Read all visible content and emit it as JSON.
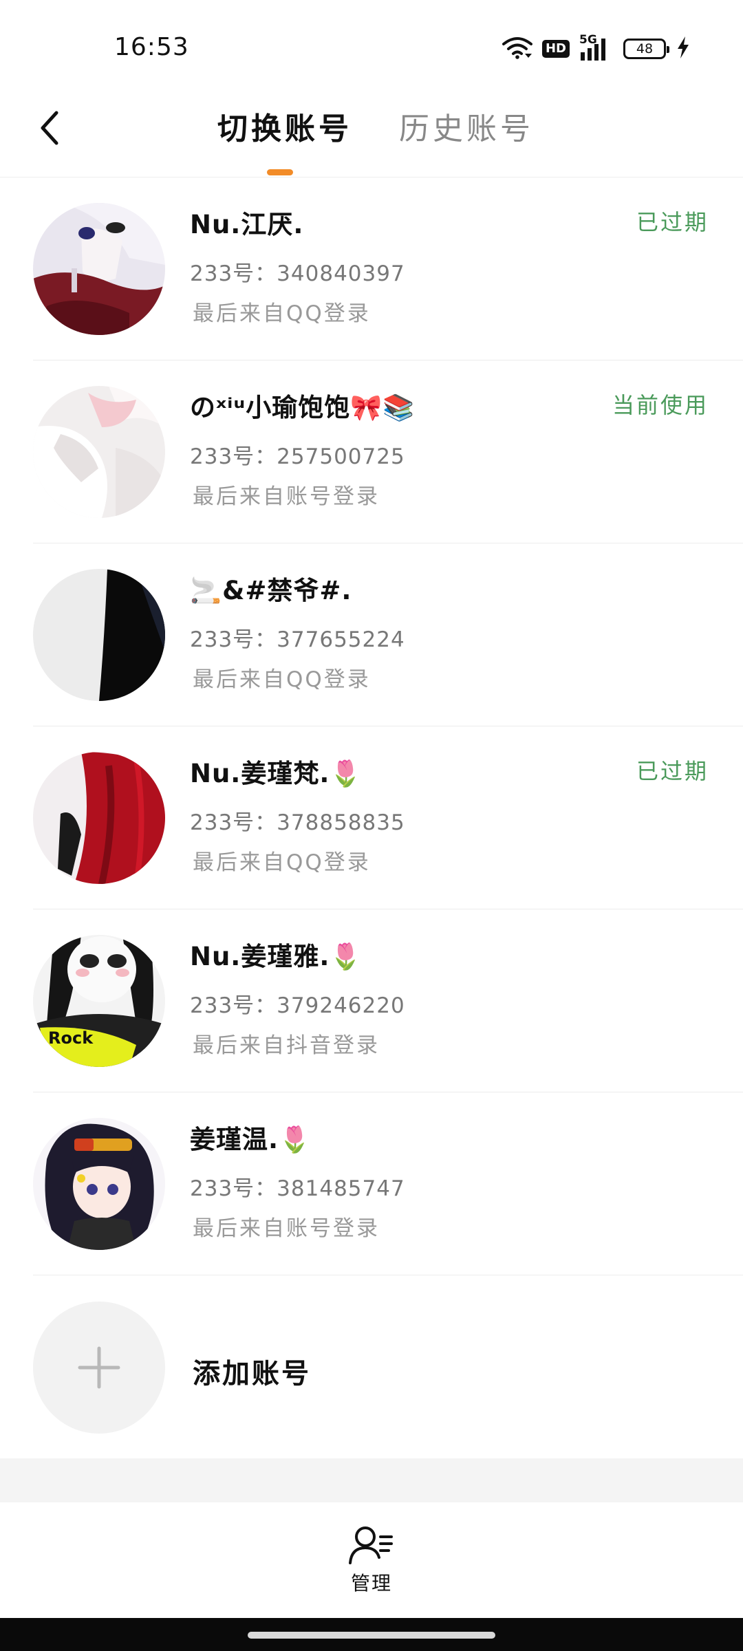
{
  "status_bar": {
    "time": "16:53",
    "hd_label": "HD",
    "network_label": "5G",
    "battery_level": "48",
    "icons": [
      "wifi-icon",
      "hd-icon",
      "signal-5g-icon",
      "battery-icon",
      "charging-bolt-icon"
    ]
  },
  "header": {
    "back_icon": "chevron-left-icon",
    "tabs": [
      {
        "label": "切换账号",
        "active": true
      },
      {
        "label": "历史账号",
        "active": false
      }
    ],
    "accent_color": "#f28c28"
  },
  "accounts": [
    {
      "name": "Nu.江厌.",
      "id_label": "233号：",
      "id": "340840397",
      "login": "最后来自QQ登录",
      "status": "已过期"
    },
    {
      "name": "のˣⁱᵘ小瑜饱饱🎀📚",
      "id_label": "233号：",
      "id": "257500725",
      "login": "最后来自账号登录",
      "status": "当前使用"
    },
    {
      "name": "🚬&#禁爷#.",
      "id_label": "233号：",
      "id": "377655224",
      "login": "最后来自QQ登录",
      "status": ""
    },
    {
      "name": "Nu.姜瑾梵.🌷",
      "id_label": "233号：",
      "id": "378858835",
      "login": "最后来自QQ登录",
      "status": "已过期"
    },
    {
      "name": "Nu.姜瑾雅.🌷",
      "id_label": "233号：",
      "id": "379246220",
      "login": "最后来自抖音登录",
      "status": ""
    },
    {
      "name": "姜瑾温.🌷",
      "id_label": "233号：",
      "id": "381485747",
      "login": "最后来自账号登录",
      "status": ""
    }
  ],
  "status_color": "#4a9a5a",
  "add_account": {
    "label": "添加账号",
    "icon": "plus-icon"
  },
  "bottom_nav": {
    "manage_label": "管理",
    "icon": "user-manage-icon"
  }
}
